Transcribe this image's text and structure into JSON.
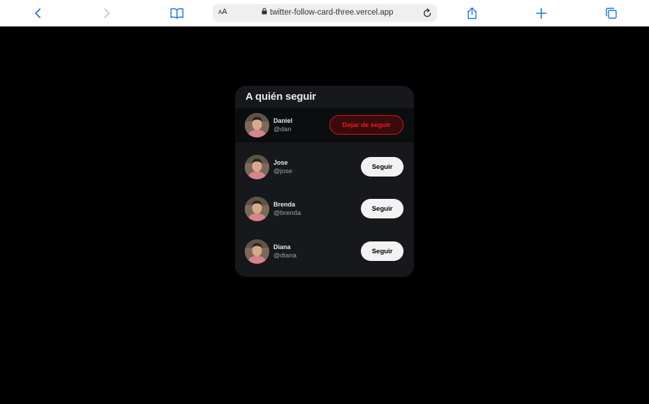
{
  "browser": {
    "aa_label_small": "A",
    "aa_label_big": "A",
    "url": "twitter-follow-card-three.vercel.app",
    "icons": [
      "back-icon",
      "forward-icon",
      "bookmarks-icon",
      "lock-icon",
      "reload-icon",
      "share-icon",
      "new-tab-icon",
      "tabs-icon"
    ]
  },
  "card": {
    "title": "A quién seguir",
    "users": [
      {
        "name": "Daniel",
        "handle": "@dan",
        "button": "Dejar de seguir",
        "following": true
      },
      {
        "name": "Jose",
        "handle": "@jose",
        "button": "Seguir",
        "following": false
      },
      {
        "name": "Brenda",
        "handle": "@brenda",
        "button": "Seguir",
        "following": false
      },
      {
        "name": "Diana",
        "handle": "@diana",
        "button": "Seguir",
        "following": false
      }
    ]
  },
  "colors": {
    "page_bg": "#000000",
    "card_bg": "#16181c",
    "accent_blue": "#1a73e8",
    "unfollow_red": "#e62020"
  }
}
